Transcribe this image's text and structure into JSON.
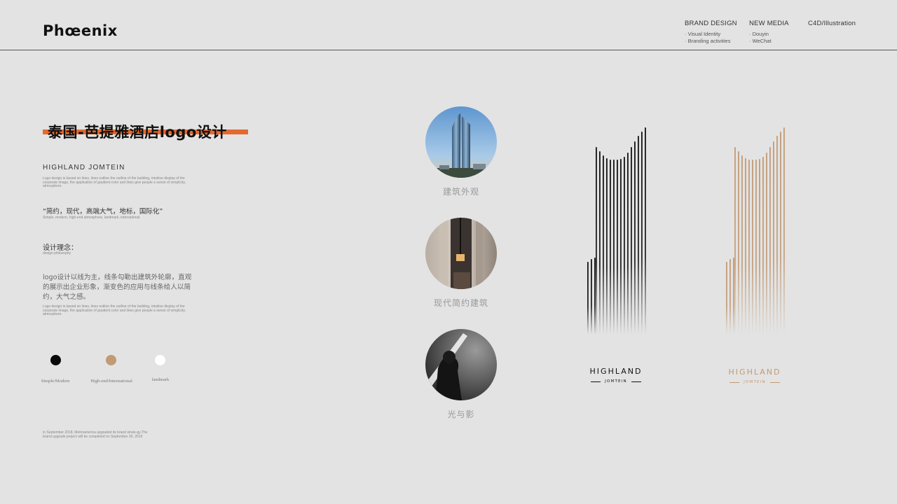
{
  "header": {
    "logo_text": "Phœenix",
    "nav": [
      {
        "title": "BRAND DESIGN",
        "items": [
          "· Visual Identity",
          "· Branding activities"
        ]
      },
      {
        "title": "NEW MEDIA",
        "items": [
          "· Douyin",
          "· WeChat"
        ]
      },
      {
        "title": "C4D/Illustration",
        "items": []
      }
    ]
  },
  "left": {
    "title": "泰国-芭提雅酒店logo设计",
    "brand_name": "HIGHLAND JOMTEIN",
    "brand_desc": "Logo design is based on lines, lines outline the outline of the building, intuitive display of the corporate image, the application of gradient color and lines give people a sense of simplicity, atmosphere.",
    "quote": "“简约，现代，高端大气，地标，国际化”",
    "quote_en": "Simple, modern, high-end atmosphere, landmark, international",
    "philosophy_label": "设计理念：",
    "philosophy_en": "design philosophy",
    "philosophy_body": "logo设计以线为主，线条勾勒出建筑外轮廓，直观的展示出企业形象，渐变色的应用与线条给人以简约，大气之感。",
    "philosophy_body_en": "Logo design is based on lines, lines outline the outline of the building, intuitive display of the corporate image, the application of gradient color and lines give people a sense of simplicity, atmosphere.",
    "swatches": [
      {
        "label": "Simple/Modern",
        "color": "#0a0a0a"
      },
      {
        "label": "High-end/International",
        "color": "#c29a74"
      },
      {
        "label": "landmark",
        "color": "#ffffff"
      }
    ],
    "foot_note": "In September 2018, Metroamerica upgraded its brand strate-gy.The brand upgrade project will be completed on September 30, 2019"
  },
  "middle": {
    "captions": [
      "建筑外观",
      "现代简约建筑",
      "光与影"
    ]
  },
  "logos": [
    {
      "word": "HIGHLAND",
      "sub": "JOMTEIN",
      "color": "#111111"
    },
    {
      "word": "HIGHLAND",
      "sub": "JOMTEIN",
      "color": "#c29a74"
    }
  ]
}
